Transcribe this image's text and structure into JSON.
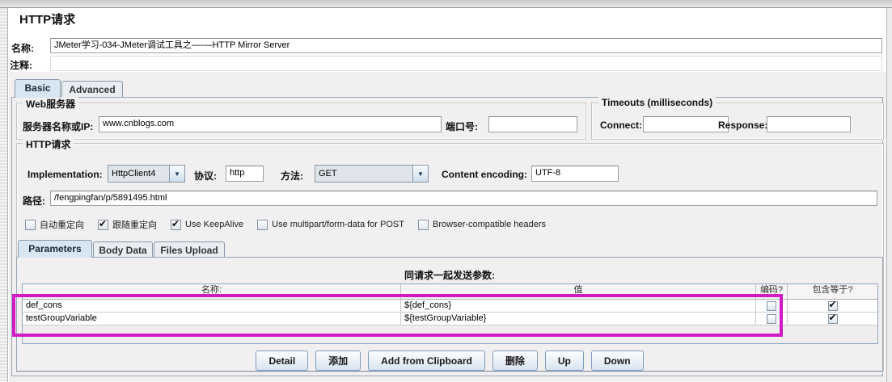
{
  "page": {
    "title": "HTTP请求"
  },
  "fields": {
    "name": {
      "label": "名称:",
      "value": "JMeter学习-034-JMeter调试工具之—-—HTTP Mirror Server"
    },
    "comments": {
      "label": "注释:",
      "value": ""
    }
  },
  "main_tabs": [
    {
      "label": "Basic",
      "selected": true
    },
    {
      "label": "Advanced",
      "selected": false
    }
  ],
  "web_server": {
    "title": "Web服务器",
    "server": {
      "label": "服务器名称或IP:",
      "value": "www.cnblogs.com"
    },
    "port": {
      "label": "端口号:",
      "value": ""
    }
  },
  "timeouts": {
    "title": "Timeouts (milliseconds)",
    "connect": {
      "label": "Connect:",
      "value": ""
    },
    "response": {
      "label": "Response:",
      "value": ""
    }
  },
  "http": {
    "title": "HTTP请求",
    "implementation": {
      "label": "Implementation:",
      "value": "HttpClient4"
    },
    "protocol": {
      "label": "协议:",
      "value": "http"
    },
    "method": {
      "label": "方法:",
      "value": "GET"
    },
    "encoding": {
      "label": "Content encoding:",
      "value": "UTF-8"
    },
    "path": {
      "label": "路径:",
      "value": "/fengpingfan/p/5891495.html"
    },
    "options": [
      {
        "label": "自动重定向",
        "checked": false
      },
      {
        "label": "跟随重定向",
        "checked": true
      },
      {
        "label": "Use KeepAlive",
        "checked": true
      },
      {
        "label": "Use multipart/form-data for POST",
        "checked": false
      },
      {
        "label": "Browser-compatible headers",
        "checked": false
      }
    ]
  },
  "param_tabs": [
    {
      "label": "Parameters",
      "selected": true
    },
    {
      "label": "Body Data",
      "selected": false
    },
    {
      "label": "Files Upload",
      "selected": false
    }
  ],
  "params": {
    "caption": "同请求一起发送参数:",
    "columns": [
      "名称:",
      "值",
      "编码?",
      "包含等于?"
    ],
    "rows": [
      {
        "name": "def_cons",
        "value": "${def_cons}",
        "encode": false,
        "include_equals": true
      },
      {
        "name": "testGroupVariable",
        "value": "${testGroupVariable}",
        "encode": false,
        "include_equals": true
      }
    ]
  },
  "footer": {
    "buttons": [
      "Detail",
      "添加",
      "Add from Clipboard",
      "删除",
      "Up",
      "Down"
    ]
  },
  "highlight": {
    "color": "#d11ac6"
  },
  "icons": {
    "dropdown_arrow": "▼"
  }
}
